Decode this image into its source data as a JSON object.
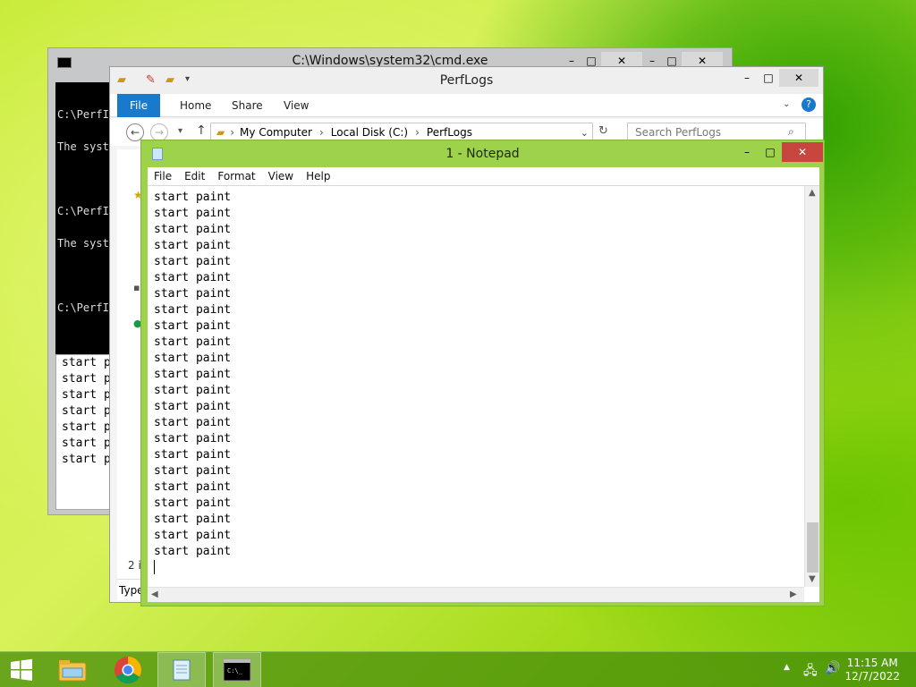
{
  "cmd": {
    "title": "C:\\Windows\\system32\\cmd.exe",
    "console_lines": [
      "C:\\PerfI",
      "The syst",
      "",
      "C:\\PerfI",
      "The syst",
      "",
      "C:\\PerfI"
    ],
    "lower_lines": [
      "start p",
      "start p",
      "start p",
      "start p",
      "start p",
      "start p",
      "start p"
    ]
  },
  "explorer": {
    "title": "PerfLogs",
    "tabs": {
      "file": "File",
      "home": "Home",
      "share": "Share",
      "view": "View"
    },
    "breadcrumb": {
      "c1": "My Computer",
      "c2": "Local Disk (C:)",
      "c3": "PerfLogs"
    },
    "search_placeholder": "Search PerfLogs",
    "status": "2 i",
    "type_header": "Type"
  },
  "notepad": {
    "title": "1 - Notepad",
    "menu": {
      "file": "File",
      "edit": "Edit",
      "format": "Format",
      "view": "View",
      "help": "Help"
    },
    "lines": [
      "start paint",
      "start paint",
      "start paint",
      "start paint",
      "start paint",
      "start paint",
      "start paint",
      "start paint",
      "start paint",
      "start paint",
      "start paint",
      "start paint",
      "start paint",
      "start paint",
      "start paint",
      "start paint",
      "start paint",
      "start paint",
      "start paint",
      "start paint",
      "start paint",
      "start paint",
      "start paint"
    ]
  },
  "taskbar": {
    "time": "11:15 AM",
    "date": "12/7/2022"
  },
  "colors": {
    "taskbar": "#468c0a",
    "notepad_frame": "#9ed24a",
    "ribbon_file": "#1979ca"
  }
}
